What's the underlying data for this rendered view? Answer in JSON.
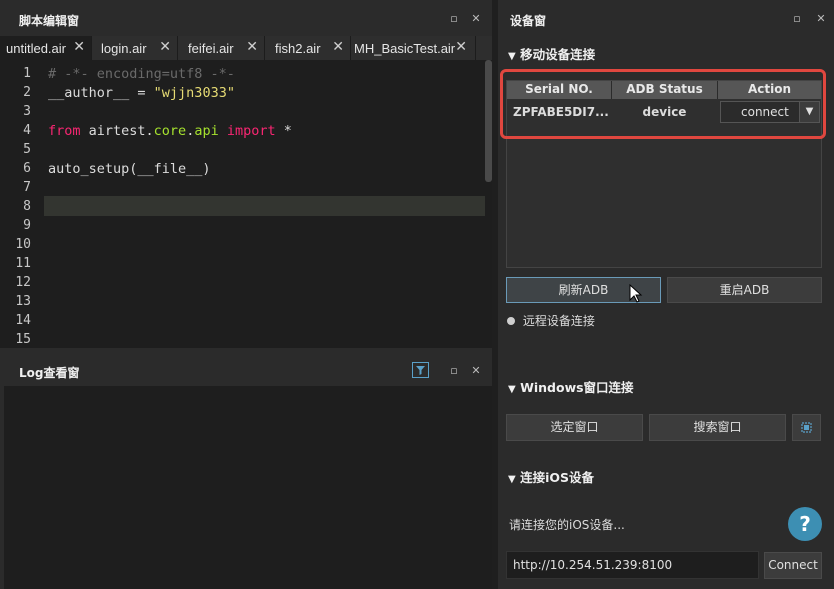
{
  "editor_panel": {
    "title": "脚本编辑窗",
    "tabs": [
      {
        "label": "untitled.air"
      },
      {
        "label": "login.air"
      },
      {
        "label": "feifei.air"
      },
      {
        "label": "fish2.air"
      },
      {
        "label": "MH_BasicTest.air"
      }
    ],
    "line_numbers": [
      "1",
      "2",
      "3",
      "4",
      "5",
      "6",
      "7",
      "8",
      "9",
      "10",
      "11",
      "12",
      "13",
      "14",
      "15"
    ],
    "code": {
      "line1": "# -*- encoding=utf8 -*-",
      "line2_a": "__author__ = ",
      "line2_b": "\"wjjn3033\"",
      "line3_a": "from",
      "line3_b": " airtest.",
      "line3_c": "core",
      "line3_d": ".",
      "line3_e": "api",
      "line3_f": " import",
      "line3_g": " *",
      "line6": "auto_setup(__file__)"
    }
  },
  "log_panel": {
    "title": "Log查看窗"
  },
  "device_panel": {
    "title": "设备窗",
    "mobile_section": "移动设备连接",
    "table": {
      "headers": [
        "Serial NO.",
        "ADB Status",
        "Action"
      ],
      "rows": [
        {
          "serial": "ZPFABE5DI7...",
          "status": "device",
          "action": "connect"
        }
      ]
    },
    "refresh_adb": "刷新ADB",
    "restart_adb": "重启ADB",
    "remote_connect": "远程设备连接",
    "windows_section": "Windows窗口连接",
    "select_window": "选定窗口",
    "search_window": "搜索窗口",
    "ios_section": "连接iOS设备",
    "ios_prompt": "请连接您的iOS设备...",
    "ios_url": "http://10.254.51.239:8100",
    "connect_label": "Connect",
    "help_glyph": "?"
  },
  "colors": {
    "highlight_border": "#e0473f",
    "accent": "#5aa0c8"
  }
}
